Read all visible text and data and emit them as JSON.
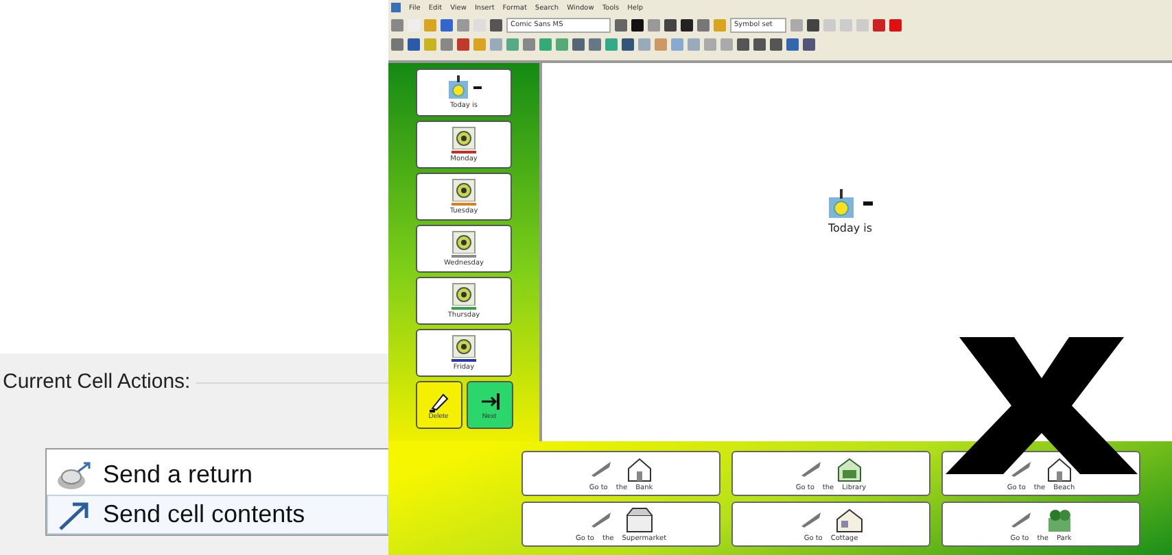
{
  "dialog": {
    "section_label": "Current Cell Actions:",
    "actions": [
      {
        "label": "Send a return",
        "kind": "return",
        "selected": false
      },
      {
        "label": "Send cell contents",
        "kind": "contents",
        "selected": true
      }
    ]
  },
  "app": {
    "menu": [
      "File",
      "Edit",
      "View",
      "Insert",
      "Format",
      "Search",
      "Window",
      "Tools",
      "Help"
    ],
    "font_field": "Comic Sans MS",
    "style_field": "Symbol set",
    "side_cells": [
      {
        "label": "Today is",
        "kind": "today"
      },
      {
        "label": "Monday",
        "kind": "day",
        "color": "#c0302a"
      },
      {
        "label": "Tuesday",
        "kind": "day",
        "color": "#d9821e"
      },
      {
        "label": "Wednesday",
        "kind": "day",
        "color": "#8a8a8a"
      },
      {
        "label": "Thursday",
        "kind": "day",
        "color": "#3aa04a"
      },
      {
        "label": "Friday",
        "kind": "day",
        "color": "#2a3aa8"
      }
    ],
    "side_buttons": [
      {
        "label": "Delete",
        "kind": "delete"
      },
      {
        "label": "Next",
        "kind": "next"
      }
    ],
    "canvas_item": {
      "label": "Today is"
    },
    "bottom_cells": [
      {
        "words": [
          "Go to",
          "the",
          "Bank"
        ],
        "kind": "house"
      },
      {
        "words": [
          "Go to",
          "the",
          "Library"
        ],
        "kind": "library"
      },
      {
        "words": [
          "Go to",
          "the",
          "Beach"
        ],
        "kind": "house"
      },
      {
        "words": [
          "Go to",
          "the",
          "Supermarket"
        ],
        "kind": "shop"
      },
      {
        "words": [
          "Go to",
          "Cottage"
        ],
        "kind": "cottage"
      },
      {
        "words": [
          "Go to",
          "the",
          "Park"
        ],
        "kind": "park"
      }
    ]
  }
}
